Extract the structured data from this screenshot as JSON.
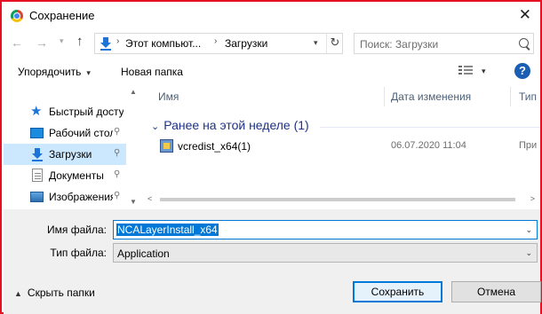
{
  "window": {
    "title": "Сохранение",
    "close_glyph": "✕"
  },
  "nav": {
    "back_glyph": "←",
    "forward_glyph": "→",
    "history_glyph": "▾",
    "up_glyph": "↑",
    "breadcrumbs": [
      "Этот компьют...",
      "Загрузки"
    ],
    "separator_glyph": "›",
    "address_dropdown_glyph": "▾",
    "refresh_glyph": "↻",
    "search_placeholder": "Поиск: Загрузки"
  },
  "toolbar": {
    "organize_label": "Упорядочить",
    "organize_arrow": "▾",
    "new_folder_label": "Новая папка",
    "view_dropdown_glyph": "▾",
    "help_glyph": "?"
  },
  "sidebar": {
    "items": [
      {
        "label": "Быстрый доступ",
        "icon": "star-icon",
        "pinned": false,
        "selected": false
      },
      {
        "label": "Рабочий стол",
        "icon": "desktop-icon",
        "pinned": true,
        "selected": false
      },
      {
        "label": "Загрузки",
        "icon": "download-icon",
        "pinned": true,
        "selected": true
      },
      {
        "label": "Документы",
        "icon": "documents-icon",
        "pinned": true,
        "selected": false
      },
      {
        "label": "Изображения",
        "icon": "pictures-icon",
        "pinned": true,
        "selected": false
      }
    ],
    "pin_glyph": "📌",
    "scroll_up_glyph": "▲",
    "scroll_down_glyph": "▼"
  },
  "files": {
    "columns": [
      "Имя",
      "Дата изменения",
      "Тип"
    ],
    "group_label": "Ранее на этой неделе (1)",
    "group_chevron": "⌄",
    "rows": [
      {
        "name": "vcredist_x64(1)",
        "date": "06.07.2020 11:04",
        "type": "При"
      }
    ],
    "scroll_left_glyph": "<",
    "scroll_right_glyph": ">"
  },
  "form": {
    "filename_label": "Имя файла:",
    "filename_value": "NCALayerInstall_x64",
    "filetype_label": "Тип файла:",
    "filetype_value": "Application",
    "dropdown_glyph": "⌄"
  },
  "footer": {
    "hide_folders_label": "Скрыть папки",
    "hide_folders_caret": "▲",
    "save_label": "Сохранить",
    "cancel_label": "Отмена"
  },
  "colors": {
    "border": "#e81123",
    "accent": "#0078d7",
    "selection": "#cce8ff",
    "group_header": "#1e3287"
  }
}
